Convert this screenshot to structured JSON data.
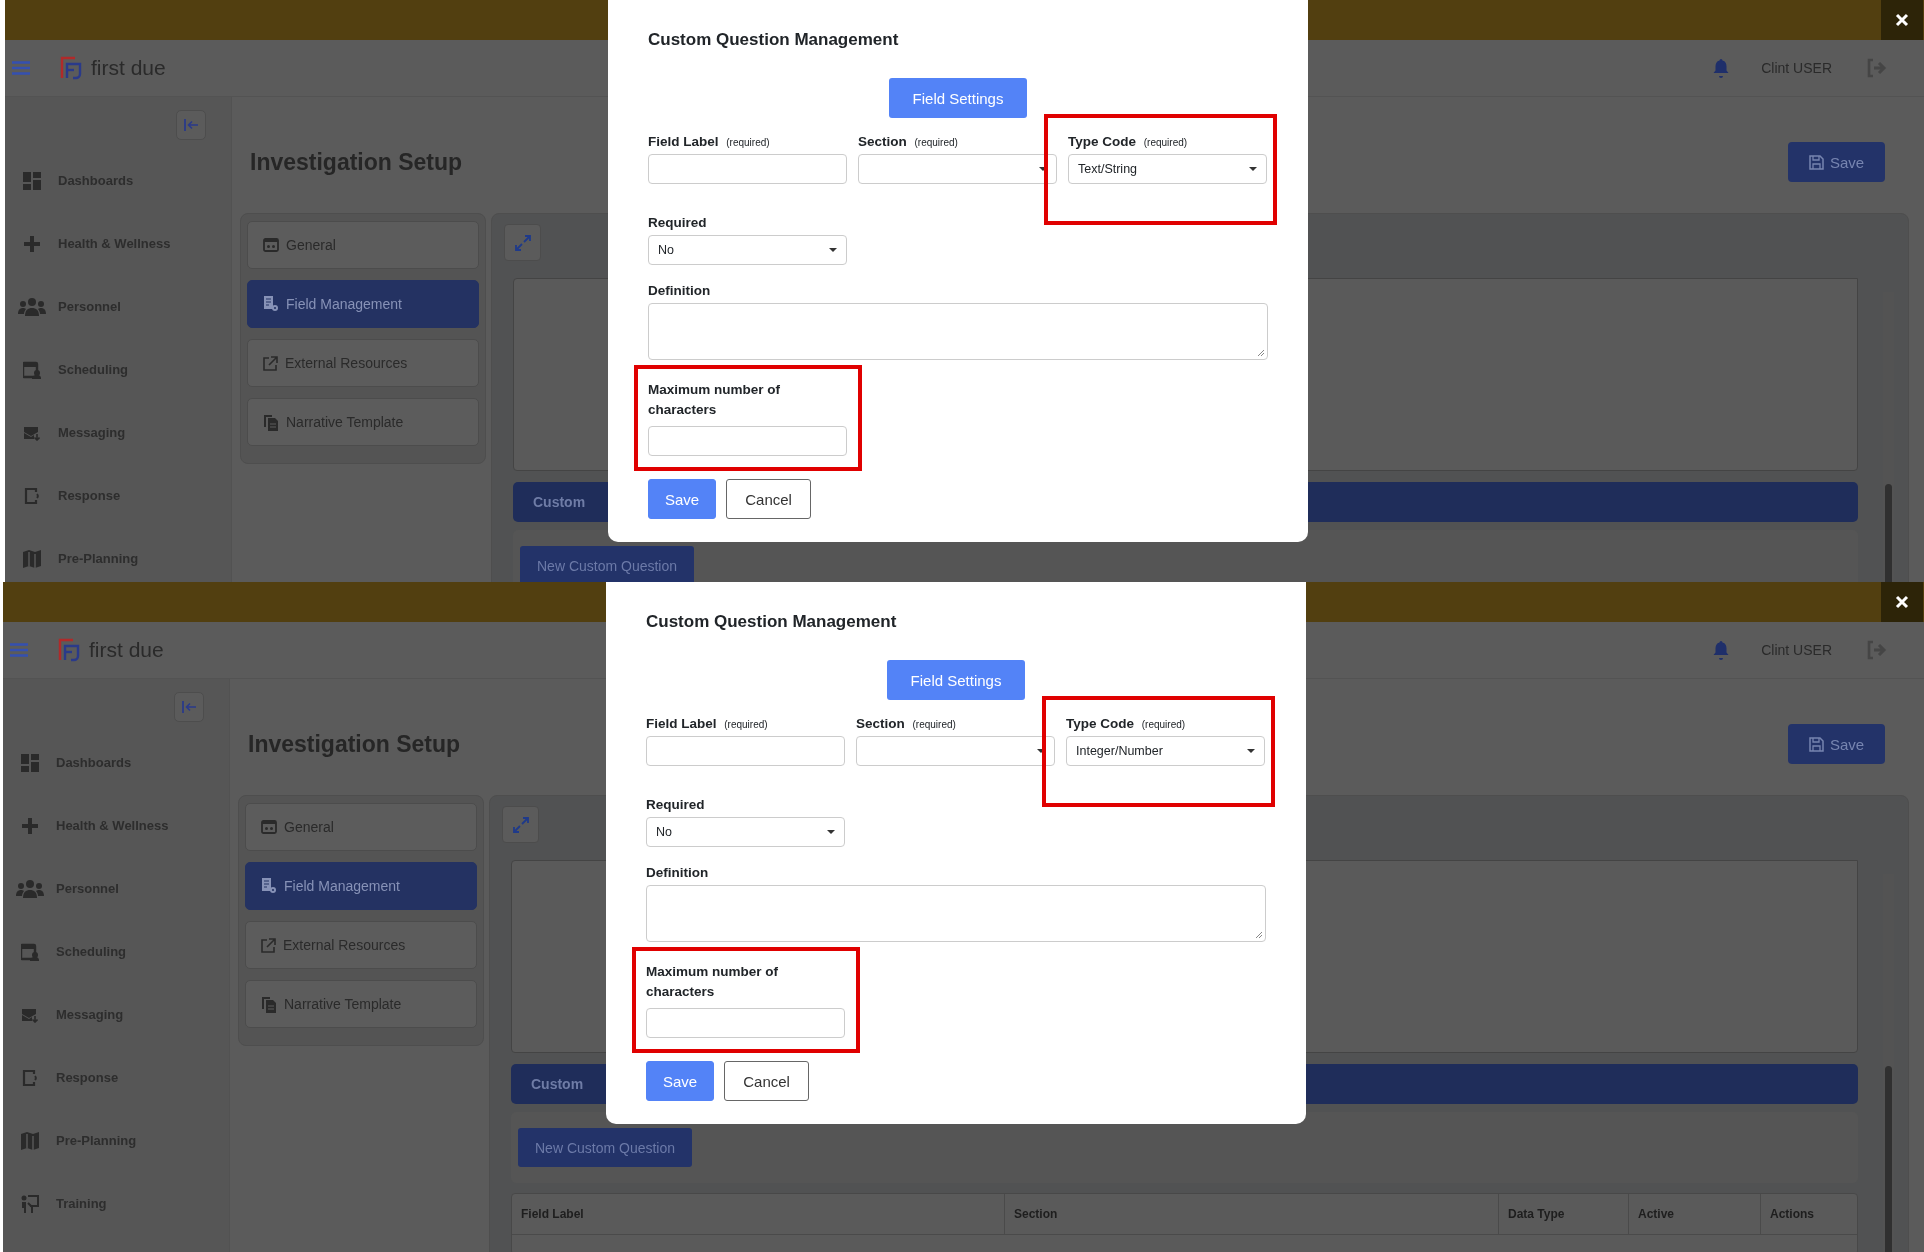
{
  "screens": [
    {
      "header": {
        "logo": "first due",
        "user": "Clint USER"
      },
      "sidebar": {
        "items": [
          {
            "label": "Dashboards"
          },
          {
            "label": "Health & Wellness"
          },
          {
            "label": "Personnel"
          },
          {
            "label": "Scheduling"
          },
          {
            "label": "Messaging"
          },
          {
            "label": "Response"
          },
          {
            "label": "Pre-Planning"
          }
        ]
      },
      "page": {
        "title": "Investigation Setup",
        "save": "Save",
        "tabs": [
          {
            "label": "General",
            "selected": false
          },
          {
            "label": "Field Management",
            "selected": true
          },
          {
            "label": "External Resources",
            "selected": false
          },
          {
            "label": "Narrative Template",
            "selected": false
          }
        ],
        "section_bar": "Custom",
        "new_button": "New Custom Question"
      },
      "modal": {
        "title": "Custom Question Management",
        "tab": "Field Settings",
        "fields": [
          {
            "kind": "text",
            "label": "Field Label",
            "hint": "(required)",
            "highlighted": false
          },
          {
            "kind": "select",
            "label": "Section",
            "hint": "(required)",
            "highlighted": false
          },
          {
            "kind": "select",
            "label": "Type Code",
            "hint": "(required)",
            "value": "Text/String",
            "highlighted": true
          }
        ],
        "required": {
          "label": "Required",
          "value": "No"
        },
        "definition": {
          "label": "Definition"
        },
        "max_chars": {
          "label": "Maximum number of characters",
          "highlighted": true
        },
        "buttons": [
          {
            "kind": "primary",
            "label": "Save"
          },
          {
            "kind": "secondary",
            "label": "Cancel"
          }
        ]
      }
    },
    {
      "header": {
        "logo": "first due",
        "user": "Clint USER"
      },
      "sidebar": {
        "items": [
          {
            "label": "Dashboards"
          },
          {
            "label": "Health & Wellness"
          },
          {
            "label": "Personnel"
          },
          {
            "label": "Scheduling"
          },
          {
            "label": "Messaging"
          },
          {
            "label": "Response"
          },
          {
            "label": "Pre-Planning"
          },
          {
            "label": "Training"
          }
        ]
      },
      "page": {
        "title": "Investigation Setup",
        "save": "Save",
        "tabs": [
          {
            "label": "General",
            "selected": false
          },
          {
            "label": "Field Management",
            "selected": true
          },
          {
            "label": "External Resources",
            "selected": false
          },
          {
            "label": "Narrative Template",
            "selected": false
          }
        ],
        "section_bar": "Custom",
        "new_button": "New Custom Question",
        "table": {
          "columns": [
            "Field Label",
            "Section",
            "Data Type",
            "Active",
            "Actions"
          ]
        }
      },
      "modal": {
        "title": "Custom Question Management",
        "tab": "Field Settings",
        "fields": [
          {
            "kind": "text",
            "label": "Field Label",
            "hint": "(required)",
            "highlighted": false
          },
          {
            "kind": "select",
            "label": "Section",
            "hint": "(required)",
            "highlighted": false
          },
          {
            "kind": "select",
            "label": "Type Code",
            "hint": "(required)",
            "value": "Integer/Number",
            "highlighted": true
          }
        ],
        "required": {
          "label": "Required",
          "value": "No"
        },
        "definition": {
          "label": "Definition"
        },
        "max_chars": {
          "label": "Maximum number of characters",
          "highlighted": true
        },
        "buttons": [
          {
            "kind": "primary",
            "label": "Save"
          },
          {
            "kind": "secondary",
            "label": "Cancel"
          }
        ]
      }
    }
  ]
}
